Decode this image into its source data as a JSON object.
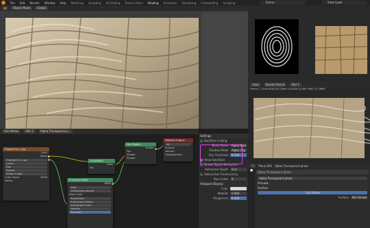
{
  "topbar": {
    "menus": [
      "File",
      "Edit",
      "Render",
      "Window",
      "Help"
    ],
    "workspaces": [
      "Modeling",
      "Sculpting",
      "UV Editing",
      "Texture Paint",
      "Shading",
      "Animation",
      "Rendering",
      "Compositing",
      "Scripting"
    ],
    "active_workspace": "Shading",
    "scene": "Scene",
    "view_layer": "View Layer"
  },
  "viewport": {
    "orientation": "Global",
    "mode": "Object Mode"
  },
  "image_editor": {
    "image": "Render Result",
    "info": "Frame:1 | Time:00:00.94 | Mem:144.00M (0.00M, Peak 377.46M)",
    "slot": "Slot 1"
  },
  "node_editor": {
    "object": "Use Nodes",
    "slot": "Slot 1",
    "material": "Alpha Transparent p..."
  },
  "nodes": {
    "image_texture": {
      "title": "Fingerprint_1.jpg",
      "out_color": "Color",
      "out_alpha": "Alpha",
      "file": "Fingerprint_1.jpg",
      "interp": "Linear",
      "proj": "Flat",
      "ext": "Repeat",
      "source": "Single Image",
      "colorspace_label": "Color Space",
      "colorspace": "sRGB",
      "vector": "Vector"
    },
    "color_ramp": {
      "title": "ColorRamp",
      "color": "Color",
      "alpha": "Alpha",
      "fac": "Fac"
    },
    "principled": {
      "title": "Principled BSDF",
      "bsdf": "BSDF",
      "dist": "GGX",
      "sss": "Christensen-Burley",
      "base_color": "Base Color",
      "subsurface": "Subsurface",
      "subsurface_radius": "Subsurface Radius",
      "subsurface_color": "Subsurface Color",
      "metallic": "Metallic",
      "specular": "Specular"
    },
    "mix_shader": {
      "title": "Mix Shader",
      "shader_out": "Shader",
      "fac": "Fac",
      "shader_a": "Shader",
      "shader_b": "Shader"
    },
    "material_output": {
      "title": "Material Output",
      "target": "All",
      "surface": "Surface",
      "volume": "Volume",
      "displacement": "Displacement"
    }
  },
  "settings": {
    "title": "Settings",
    "backface_culling": "Backface Culling",
    "blend_mode_label": "Blend Mode",
    "blend_mode": "Alpha Blend",
    "shadow_mode_label": "Shadow Mode",
    "shadow_mode": "Alpha Clip",
    "clip_threshold_label": "Clip Threshold",
    "clip_threshold": "0.500",
    "show_backface": "Show Backface",
    "ssr": "Screen Space Refraction",
    "refraction_depth_label": "Refraction Depth",
    "refraction_depth": "0 m",
    "sss_translucency": "Subsurface Translucency",
    "pass_index_label": "Pass Index",
    "pass_index": "0",
    "viewport_display": "Viewport Display",
    "color_label": "Color",
    "metallic_label": "Metallic",
    "metallic": "0.000",
    "roughness_label": "Roughness",
    "roughness": "0.400"
  },
  "properties": {
    "object": "Plane.001",
    "material_path": "Alpha Transparent plane",
    "material_name": "Alpha Transparent plane",
    "preview": "Preview",
    "surface": "Surface",
    "use_nodes": "Use Nodes",
    "surface_label": "Surface",
    "surface_value": "Mix Shader"
  },
  "colors": {
    "accent": "#4d73b0",
    "highlight": "#e040e0",
    "shader_node": "#3f8a5a",
    "texture_node": "#7a4a26",
    "output_node": "#7a2a2a"
  }
}
